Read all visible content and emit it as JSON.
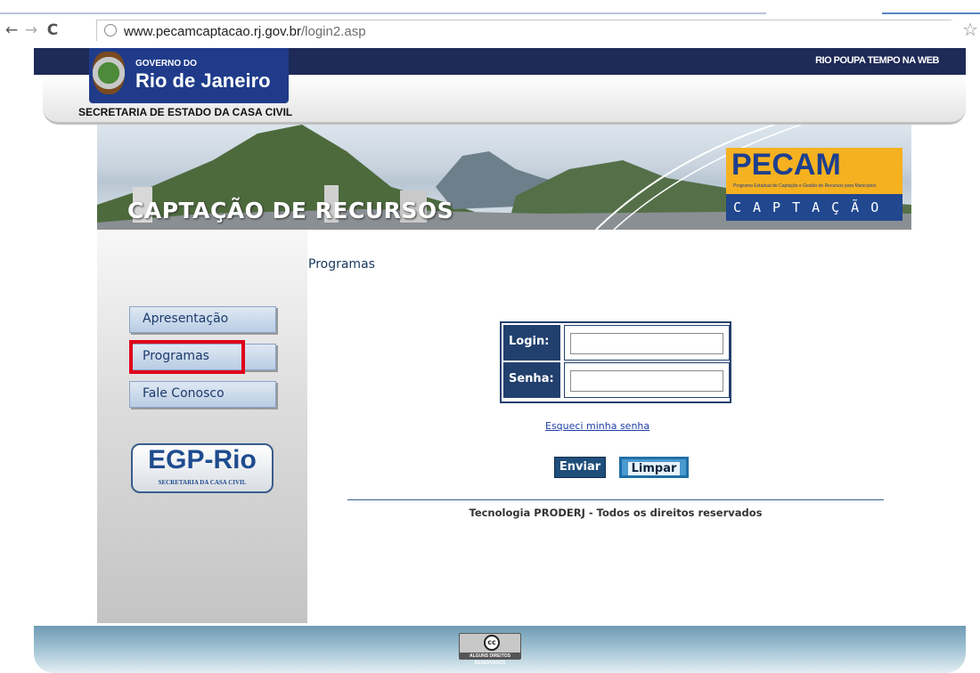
{
  "browser": {
    "url_host": "www.pecamcaptacao.rj.gov.br",
    "url_path": "/login2.asp"
  },
  "header": {
    "top_right_link": "RIO POUPA TEMPO NA WEB",
    "gov_small": "GOVERNO DO",
    "gov_big": "Rio de Janeiro",
    "secretaria": "SECRETARIA DE ESTADO DA CASA CIVIL"
  },
  "banner": {
    "title": "CAPTAÇÃO DE RECURSOS",
    "logo_word": "PECAM",
    "logo_subtitle": "Programa Estadual de Captação e Gestão de Recursos para Municípios",
    "logo_bottom": "CAPTAÇÃO"
  },
  "sidebar": {
    "items": [
      {
        "label": "Apresentação"
      },
      {
        "label": "Programas"
      },
      {
        "label": "Fale Conosco"
      }
    ],
    "egp_word": "EGP-Rio",
    "egp_sub": "SECRETARIA DA CASA CIVIL"
  },
  "main": {
    "title": "Programas",
    "login_label": "Login:",
    "senha_label": "Senha:",
    "login_value": "",
    "senha_value": "",
    "forgot_link": "Esqueci minha senha",
    "submit_label": "Enviar",
    "reset_label": "Limpar",
    "copyright": "Tecnologia PRODERJ - Todos os direitos reservados"
  },
  "footer": {
    "cc_symbol": "cc",
    "cc_text": "ALGUNS DIREITOS RESERVADOS"
  },
  "colors": {
    "navy": "#1e2a57",
    "highlight": "#e0001a",
    "pecam_orange": "#f5b120",
    "pecam_blue": "#21478f"
  }
}
